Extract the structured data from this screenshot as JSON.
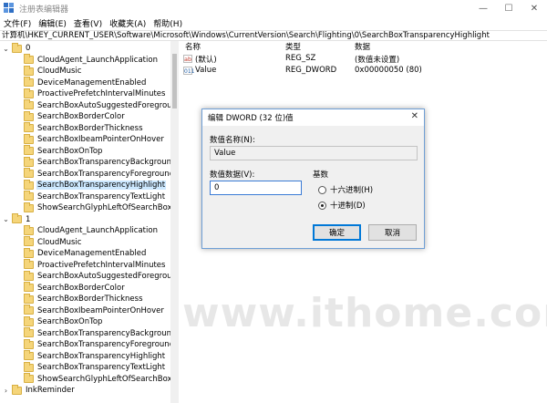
{
  "window": {
    "title": "注册表编辑器",
    "minimize": "—",
    "maximize": "☐",
    "close": "✕"
  },
  "menu": {
    "items": [
      "文件(F)",
      "编辑(E)",
      "查看(V)",
      "收藏夹(A)",
      "帮助(H)"
    ]
  },
  "address": "计算机\\HKEY_CURRENT_USER\\Software\\Microsoft\\Windows\\CurrentVersion\\Search\\Flighting\\0\\SearchBoxTransparencyHighlight",
  "tree": {
    "items": [
      {
        "label": "0",
        "expander": "⌄",
        "level": 0
      },
      {
        "label": "CloudAgent_LaunchApplication",
        "level": 1
      },
      {
        "label": "CloudMusic",
        "level": 1
      },
      {
        "label": "DeviceManagementEnabled",
        "level": 1
      },
      {
        "label": "ProactivePrefetchIntervalMinutes",
        "level": 1
      },
      {
        "label": "SearchBoxAutoSuggestedForegroundCo",
        "level": 1
      },
      {
        "label": "SearchBoxBorderColor",
        "level": 1
      },
      {
        "label": "SearchBoxBorderThickness",
        "level": 1
      },
      {
        "label": "SearchBoxIbeamPointerOnHover",
        "level": 1
      },
      {
        "label": "SearchBoxOnTop",
        "level": 1
      },
      {
        "label": "SearchBoxTransparencyBackground",
        "level": 1
      },
      {
        "label": "SearchBoxTransparencyForeground",
        "level": 1
      },
      {
        "label": "SearchBoxTransparencyHighlight",
        "level": 1,
        "selected": true
      },
      {
        "label": "SearchBoxTransparencyTextLight",
        "level": 1
      },
      {
        "label": "ShowSearchGlyphLeftOfSearchBox",
        "level": 1
      },
      {
        "label": "1",
        "expander": "⌄",
        "level": 0
      },
      {
        "label": "CloudAgent_LaunchApplication",
        "level": 1
      },
      {
        "label": "CloudMusic",
        "level": 1
      },
      {
        "label": "DeviceManagementEnabled",
        "level": 1
      },
      {
        "label": "ProactivePrefetchIntervalMinutes",
        "level": 1
      },
      {
        "label": "SearchBoxAutoSuggestedForegroundCo",
        "level": 1
      },
      {
        "label": "SearchBoxBorderColor",
        "level": 1
      },
      {
        "label": "SearchBoxBorderThickness",
        "level": 1
      },
      {
        "label": "SearchBoxIbeamPointerOnHover",
        "level": 1
      },
      {
        "label": "SearchBoxOnTop",
        "level": 1
      },
      {
        "label": "SearchBoxTransparencyBackground",
        "level": 1
      },
      {
        "label": "SearchBoxTransparencyForeground",
        "level": 1
      },
      {
        "label": "SearchBoxTransparencyHighlight",
        "level": 1
      },
      {
        "label": "SearchBoxTransparencyTextLight",
        "level": 1
      },
      {
        "label": "ShowSearchGlyphLeftOfSearchBox",
        "level": 1
      },
      {
        "label": "InkReminder",
        "expander": "›",
        "level": 0
      }
    ]
  },
  "list": {
    "headers": {
      "name": "名称",
      "type": "类型",
      "data": "数据"
    },
    "rows": [
      {
        "icon": "ab",
        "name": "(默认)",
        "type": "REG_SZ",
        "data": "(数值未设置)"
      },
      {
        "icon": "011",
        "name": "Value",
        "type": "REG_DWORD",
        "data": "0x00000050 (80)"
      }
    ]
  },
  "dialog": {
    "title": "编辑 DWORD (32 位)值",
    "close": "✕",
    "name_label": "数值名称(N):",
    "name_value": "Value",
    "data_label": "数值数据(V):",
    "data_value": "0",
    "base_label": "基数",
    "hex_label": "十六进制(H)",
    "dec_label": "十进制(D)",
    "ok": "确定",
    "cancel": "取消"
  },
  "watermark": {
    "text": "www.ithome.com"
  },
  "colors": {
    "selection": "#cce8ff",
    "dialog_border": "#6f9fd6",
    "default_button": "#0078d7",
    "folder": "#f5d57a"
  }
}
